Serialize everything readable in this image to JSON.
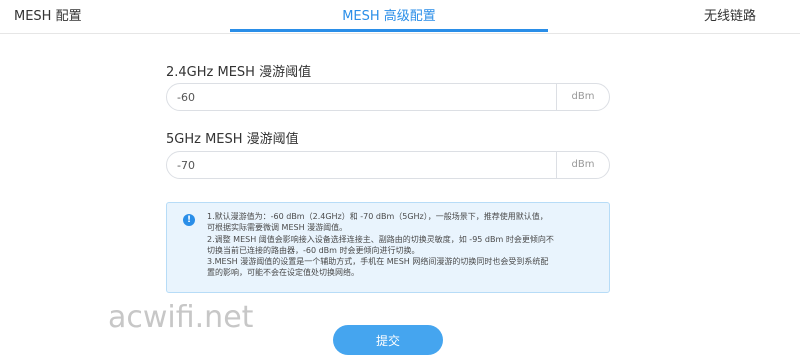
{
  "tabs": [
    {
      "label": "MESH 配置"
    },
    {
      "label": "MESH 高级配置",
      "active": true
    },
    {
      "label": "无线链路"
    }
  ],
  "fields": {
    "ghz24": {
      "label": "2.4GHz MESH 漫游阈值",
      "value": "-60",
      "unit": "dBm"
    },
    "ghz5": {
      "label": "5GHz MESH 漫游阈值",
      "value": "-70",
      "unit": "dBm"
    }
  },
  "note": {
    "icon": "info-icon",
    "lines": [
      "1.默认漫游值为：-60 dBm（2.4GHz）和 -70 dBm（5GHz），一般场景下，推荐使用默认值，",
      "可根据实际需要微调 MESH 漫游阈值。",
      "2.调整 MESH 阈值会影响接入设备选择连接主、副路由的切换灵敏度，如 -95 dBm 时会更倾向不",
      "切换当前已连接的路由器，-60 dBm 时会更倾向进行切换。",
      "3.MESH 漫游阈值的设置是一个辅助方式，手机在 MESH 网络间漫游的切换同时也会受到系统配",
      "置的影响，可能不会在设定值处切换网络。"
    ]
  },
  "submit_label": "提交",
  "watermark": "acwifi.net",
  "colors": {
    "accent": "#2a8ee8",
    "button": "#45a5ef",
    "note_bg": "#e9f4fd"
  }
}
